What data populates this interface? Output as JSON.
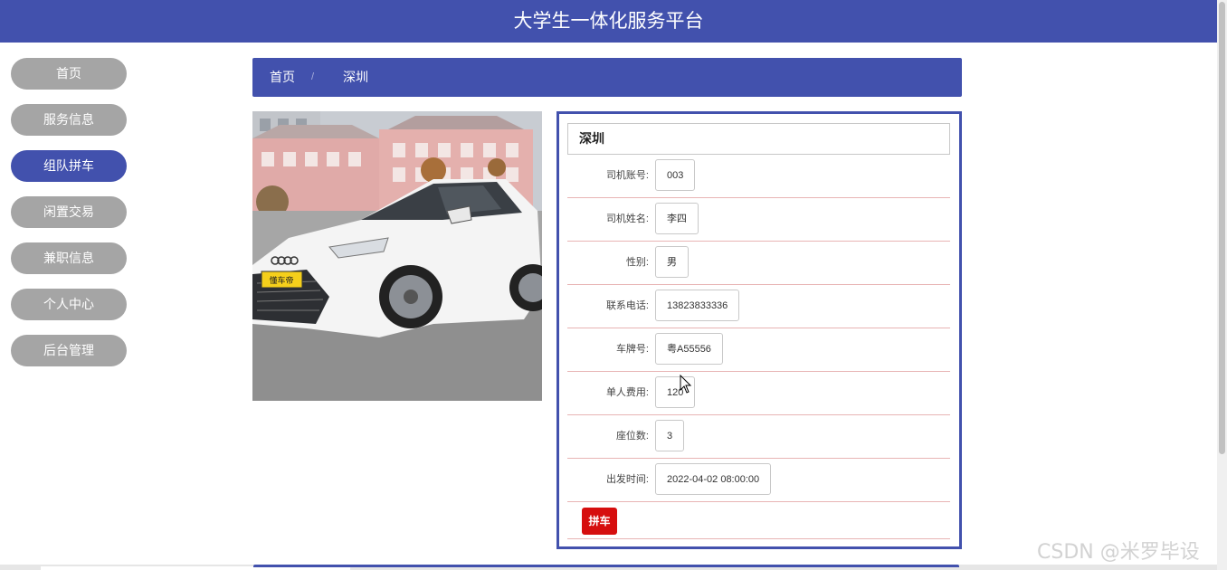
{
  "header": {
    "title": "大学生一体化服务平台"
  },
  "sidebar": {
    "items": [
      {
        "label": "首页",
        "active": false
      },
      {
        "label": "服务信息",
        "active": false
      },
      {
        "label": "组队拼车",
        "active": true
      },
      {
        "label": "闲置交易",
        "active": false
      },
      {
        "label": "兼职信息",
        "active": false
      },
      {
        "label": "个人中心",
        "active": false
      },
      {
        "label": "后台管理",
        "active": false
      }
    ]
  },
  "breadcrumb": {
    "home": "首页",
    "separator": "/",
    "current": "深圳"
  },
  "detail": {
    "title": "深圳",
    "fields": [
      {
        "label": "司机账号:",
        "value": "003"
      },
      {
        "label": "司机姓名:",
        "value": "李四"
      },
      {
        "label": "性别:",
        "value": "男"
      },
      {
        "label": "联系电话:",
        "value": "13823833336"
      },
      {
        "label": "车牌号:",
        "value": "粤A55556"
      },
      {
        "label": "单人费用:",
        "value": "120"
      },
      {
        "label": "座位数:",
        "value": "3"
      },
      {
        "label": "出发时间:",
        "value": "2022-04-02 08:00:00"
      }
    ],
    "action_label": "拼车"
  },
  "photo": {
    "plate_text": "懂车帝"
  },
  "watermark": "CSDN @米罗毕设",
  "colors": {
    "primary": "#4251ad",
    "nav_inactive": "#a5a5a5",
    "action": "#d60e0e",
    "divider": "#e8b4b4"
  }
}
